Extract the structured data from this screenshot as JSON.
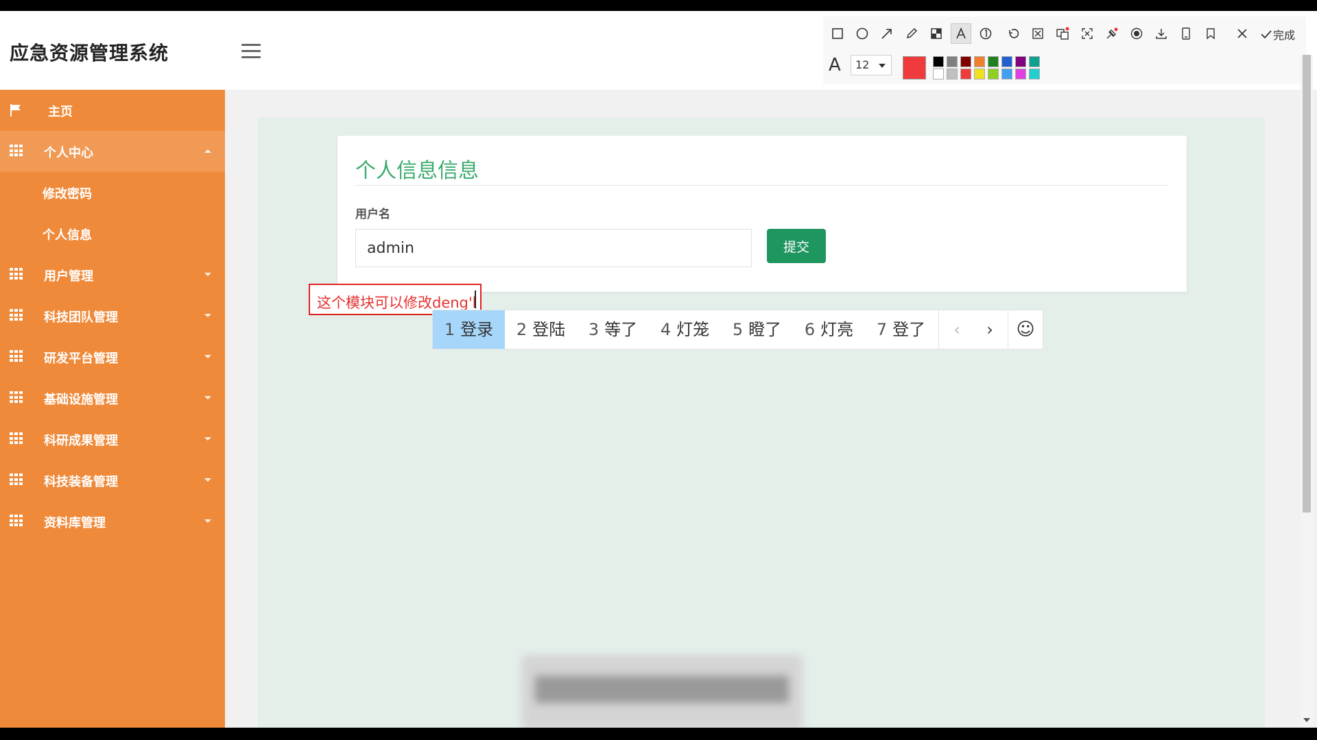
{
  "app": {
    "title": "应急资源管理系统"
  },
  "avatar": {
    "text": "80x80"
  },
  "sidebar": {
    "home": "主页",
    "personal_center": "个人中心",
    "sub_items": [
      "修改密码",
      "个人信息"
    ],
    "items": [
      "用户管理",
      "科技团队管理",
      "研发平台管理",
      "基础设施管理",
      "科研成果管理",
      "科技装备管理",
      "资料库管理"
    ]
  },
  "form": {
    "title": "个人信息信息",
    "username_label": "用户名",
    "username_value": "admin",
    "submit_label": "提交"
  },
  "annotation": {
    "text": "这个模块可以修改deng'l"
  },
  "ime": {
    "candidates": [
      {
        "num": "1",
        "text": "登录"
      },
      {
        "num": "2",
        "text": "登陆"
      },
      {
        "num": "3",
        "text": "等了"
      },
      {
        "num": "4",
        "text": "灯笼"
      },
      {
        "num": "5",
        "text": "瞪了"
      },
      {
        "num": "6",
        "text": "灯亮"
      },
      {
        "num": "7",
        "text": "登了"
      }
    ],
    "prev": "‹",
    "next": "›",
    "emoji": "☺"
  },
  "snip_toolbar": {
    "finish_label": "完成",
    "font_size": "12",
    "font_icon": "A",
    "current_color": "#ef3b3b",
    "swatches_row1": [
      "#000000",
      "#808080",
      "#800000",
      "#f08030",
      "#208020",
      "#2060d0",
      "#800080",
      "#10a090"
    ],
    "swatches_row2": [
      "#ffffff",
      "#c0c0c0",
      "#ef3b3b",
      "#f0e020",
      "#90d020",
      "#40a0f0",
      "#e040e0",
      "#20d0d0"
    ]
  }
}
